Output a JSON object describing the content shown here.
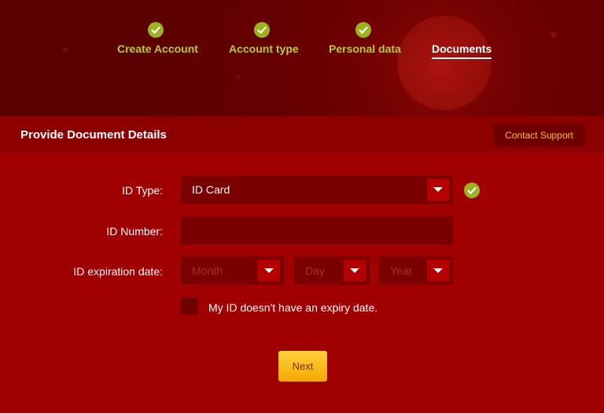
{
  "steps": [
    {
      "label": "Create Account",
      "done": true
    },
    {
      "label": "Account type",
      "done": true
    },
    {
      "label": "Personal data",
      "done": true
    },
    {
      "label": "Documents",
      "done": false,
      "active": true
    }
  ],
  "section": {
    "title": "Provide Document Details",
    "support_label": "Contact Support"
  },
  "form": {
    "id_type_label": "ID Type:",
    "id_type_value": "ID Card",
    "id_number_label": "ID Number:",
    "id_number_value": "",
    "expiration_label": "ID expiration date:",
    "month_placeholder": "Month",
    "day_placeholder": "Day",
    "year_placeholder": "Year",
    "no_expiry_label": "My ID doesn't have an expiry date."
  },
  "actions": {
    "next_label": "Next"
  },
  "colors": {
    "accent_green": "#9bb31c",
    "button_yellow": "#fbbd14",
    "background_red": "#a00000"
  }
}
